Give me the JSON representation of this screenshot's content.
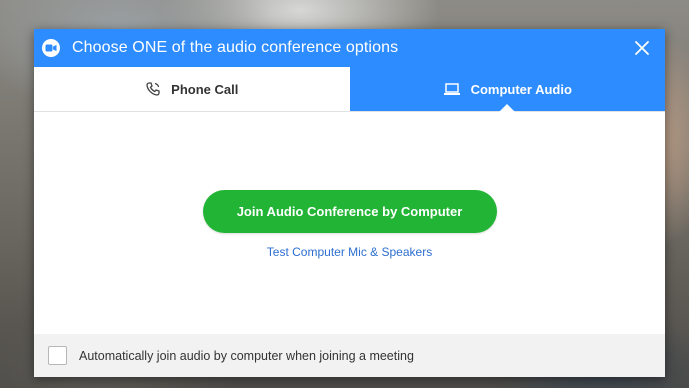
{
  "dialog": {
    "title": "Choose ONE of the audio conference options",
    "close_icon": "close-icon",
    "title_icon": "audio-conference-icon"
  },
  "tabs": [
    {
      "label": "Phone Call",
      "icon": "phone-icon",
      "selected": false
    },
    {
      "label": "Computer Audio",
      "icon": "computer-icon",
      "selected": true
    }
  ],
  "main": {
    "join_button_label": "Join Audio Conference by Computer",
    "test_link_label": "Test Computer Mic & Speakers"
  },
  "footer": {
    "checkbox_checked": false,
    "checkbox_label": "Automatically join audio by computer when joining a meeting"
  },
  "colors": {
    "accent": "#2d8cff",
    "join_button": "#22b535",
    "link": "#2d6fd1"
  }
}
